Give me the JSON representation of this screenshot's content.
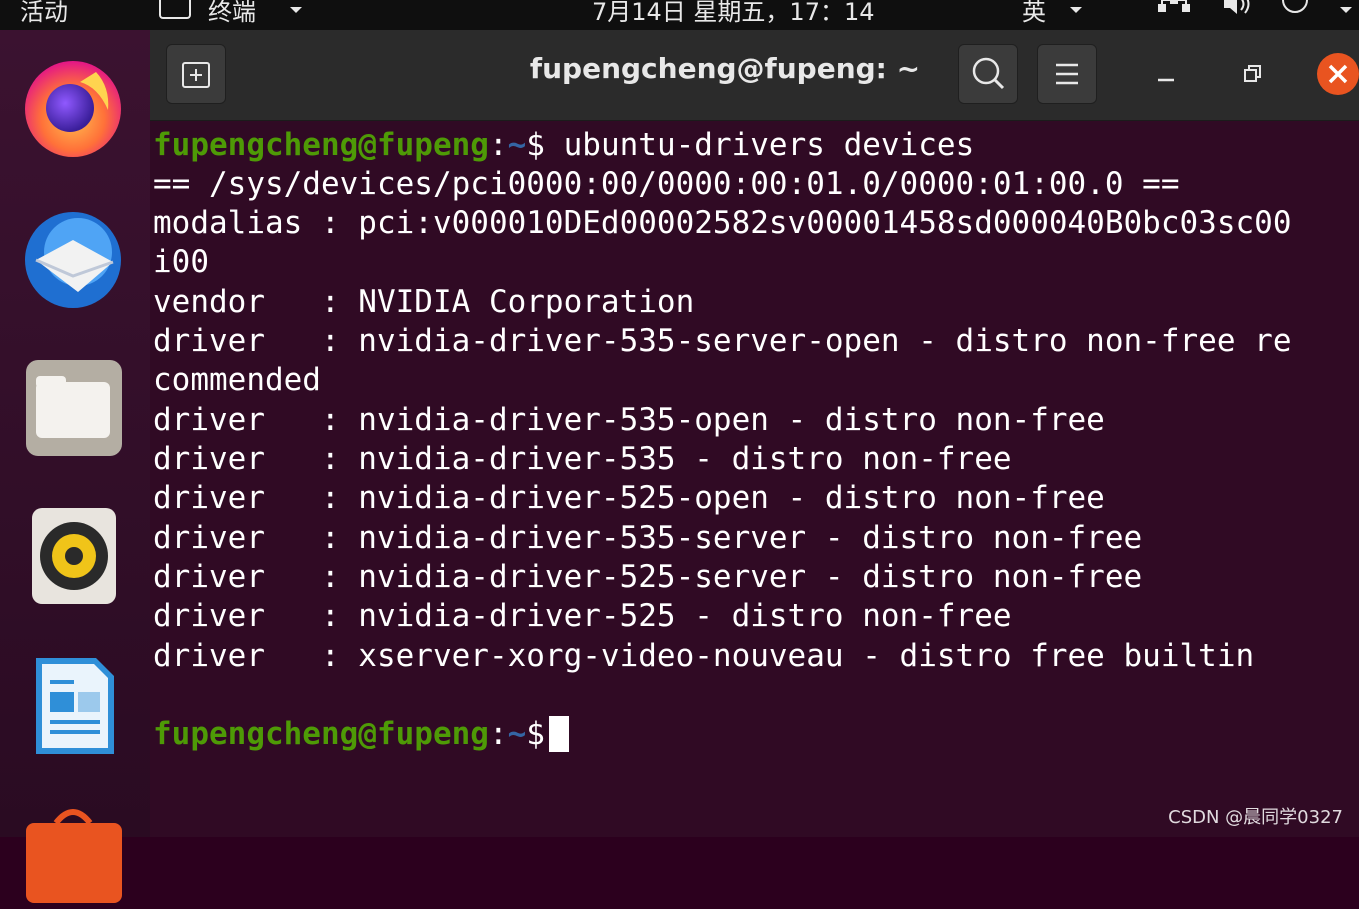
{
  "topbar": {
    "activities": "活动",
    "app_menu_label": "终端",
    "clock": "7月14日 星期五，17：14",
    "input_method": "英"
  },
  "dock": {
    "items": [
      "firefox",
      "thunderbird",
      "files",
      "rhythmbox",
      "libreoffice-writer",
      "software"
    ]
  },
  "window": {
    "title": "fupengcheng@fupeng: ~"
  },
  "terminal": {
    "prompt_user": "fupengcheng@fupeng",
    "prompt_sep": ":",
    "prompt_path": "~",
    "prompt_symbol": "$",
    "command": " ubuntu-drivers devices",
    "output": [
      "== /sys/devices/pci0000:00/0000:00:01.0/0000:01:00.0 ==",
      "modalias : pci:v000010DEd00002582sv00001458sd000040B0bc03sc00",
      "i00",
      "vendor   : NVIDIA Corporation",
      "driver   : nvidia-driver-535-server-open - distro non-free re",
      "commended",
      "driver   : nvidia-driver-535-open - distro non-free",
      "driver   : nvidia-driver-535 - distro non-free",
      "driver   : nvidia-driver-525-open - distro non-free",
      "driver   : nvidia-driver-535-server - distro non-free",
      "driver   : nvidia-driver-525-server - distro non-free",
      "driver   : nvidia-driver-525 - distro non-free",
      "driver   : xserver-xorg-video-nouveau - distro free builtin"
    ]
  },
  "watermark": "CSDN @晨同学0327",
  "colors": {
    "terminal_bg": "#300a24",
    "prompt_user": "#4e9a06",
    "prompt_path": "#3465a4",
    "close_button": "#e95420"
  }
}
